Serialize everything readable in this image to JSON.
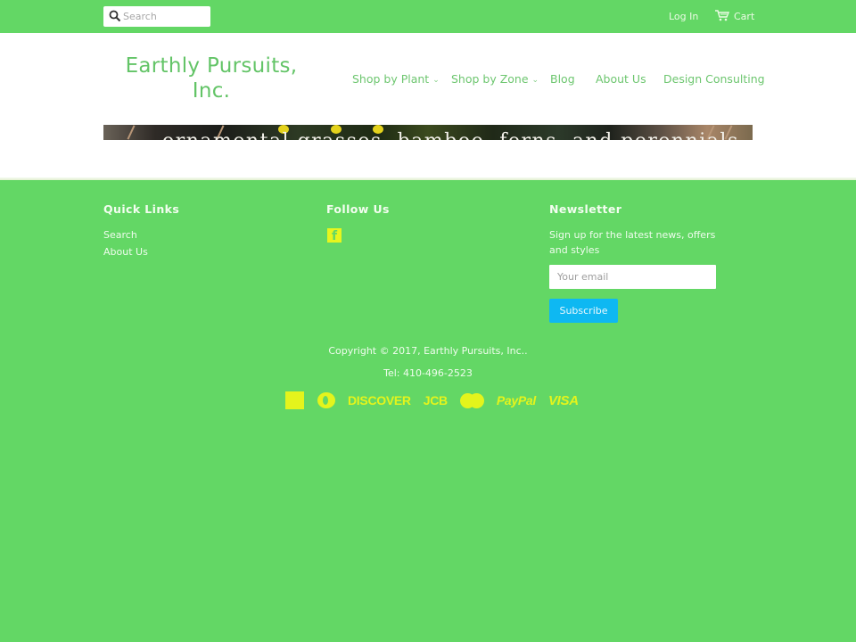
{
  "topbar": {
    "search_placeholder": "Search",
    "login_label": "Log In",
    "cart_label": "Cart"
  },
  "header": {
    "logo": "Earthly Pursuits, Inc.",
    "nav": [
      {
        "label": "Shop by Plant",
        "has_dropdown": true
      },
      {
        "label": "Shop by Zone",
        "has_dropdown": true
      },
      {
        "label": "Blog",
        "has_dropdown": false
      },
      {
        "label": "About Us",
        "has_dropdown": false
      },
      {
        "label": "Design Consulting",
        "has_dropdown": false
      }
    ],
    "chevron": "⌄",
    "banner_text": "ornamental grasses, bamboo, ferns, and perennials"
  },
  "footer": {
    "quick_links": {
      "title": "Quick Links",
      "items": [
        "Search",
        "About Us"
      ]
    },
    "follow_us": {
      "title": "Follow Us",
      "icons": [
        "facebook-icon"
      ]
    },
    "newsletter": {
      "title": "Newsletter",
      "text": "Sign up for the latest news, offers and styles",
      "email_placeholder": "Your email",
      "subscribe_label": "Subscribe"
    },
    "copyright": "Copyright © 2017, Earthly Pursuits, Inc..",
    "tel": "Tel: 410-496-2523",
    "payments": [
      "American Express",
      "Diners Club",
      "DISCOVER",
      "JCB",
      "Master",
      "PayPal",
      "VISA"
    ]
  },
  "colors": {
    "brand_green": "#63d765",
    "link_green": "#6dc66f",
    "subscribe_blue": "#0eb8f2",
    "icon_yellow": "#e4f41c"
  }
}
